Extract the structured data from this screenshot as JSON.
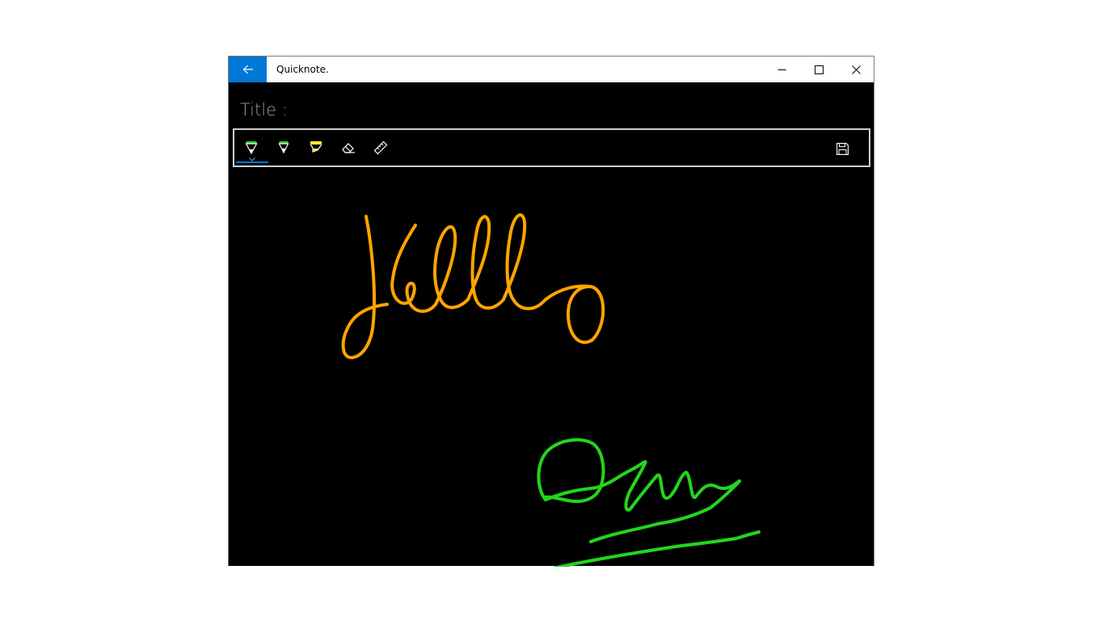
{
  "window": {
    "app_title": "Quicknote."
  },
  "editor": {
    "title_label": "Title :"
  },
  "icons": {
    "back": "back-arrow-icon",
    "minimize": "minimize-icon",
    "maximize": "maximize-icon",
    "close": "close-icon",
    "ballpoint_pen": "ballpoint-pen-icon",
    "pencil": "pencil-icon",
    "highlighter": "highlighter-icon",
    "eraser": "eraser-icon",
    "ruler": "ruler-icon",
    "save": "save-icon"
  },
  "colors": {
    "accent": "#0078d7",
    "ink_orange": "#ffa500",
    "ink_green": "#22d61b",
    "highlighter_yellow": "#ffee33",
    "canvas": "#000000"
  },
  "toolbar": {
    "selected_tool": "ballpoint_pen"
  }
}
